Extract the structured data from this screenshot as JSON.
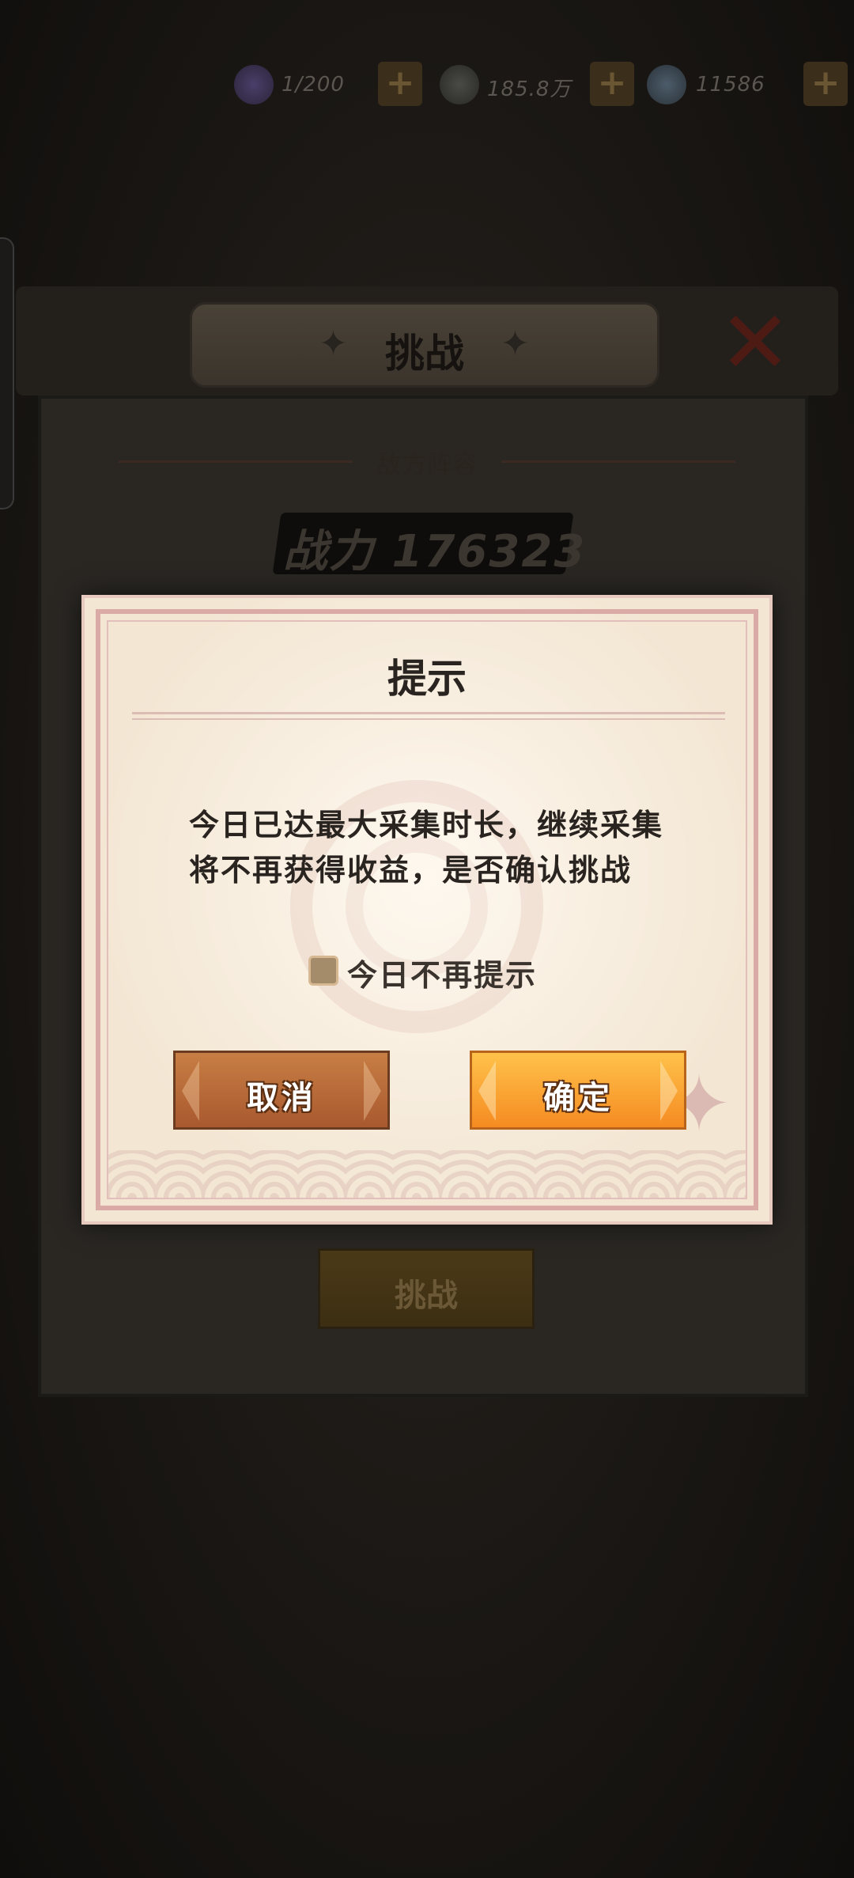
{
  "resources": [
    {
      "name": "stamina",
      "value": "1/200",
      "icon": "purple-orb-icon",
      "color": "#3a3350"
    },
    {
      "name": "coins",
      "value": "185.8万",
      "icon": "coin-icon",
      "color": "#3a3a38"
    },
    {
      "name": "gems",
      "value": "11586",
      "icon": "blue-gem-icon",
      "color": "#3a4a55"
    }
  ],
  "plus_label": "+",
  "panel": {
    "title": "挑战",
    "enemy_label": "敌方阵容",
    "power_text": "战力 176323",
    "challenge_button": "挑战",
    "close_glyph": "✕"
  },
  "dialog": {
    "title": "提示",
    "message": "今日已达最大采集时长，继续采集将不再获得收益，是否确认挑战",
    "checkbox_label": "今日不再提示",
    "checkbox_checked": false,
    "cancel_label": "取消",
    "confirm_label": "确定",
    "cancel_color": "#b8683a",
    "confirm_color": "#f7a336"
  }
}
